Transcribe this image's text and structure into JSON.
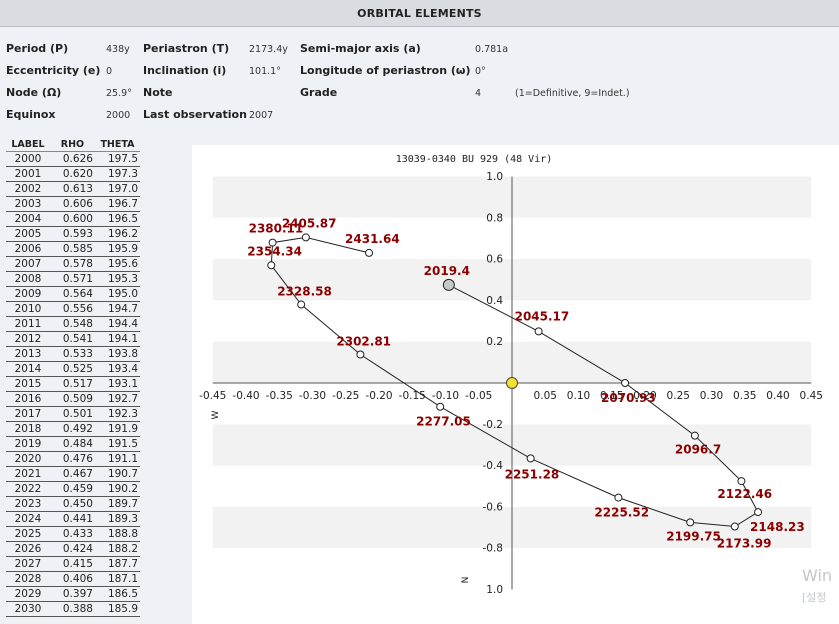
{
  "header": {
    "title": "ORBITAL ELEMENTS"
  },
  "elements": {
    "period_label": "Period (P)",
    "period_value": "438y",
    "periastron_label": "Periastron (T)",
    "periastron_value": "2173.4y",
    "semimajor_label": "Semi-major axis (a)",
    "semimajor_value": "0.781a",
    "ecc_label": "Eccentricity (e)",
    "ecc_value": "0",
    "incl_label": "Inclination (i)",
    "incl_value": "101.1°",
    "longperi_label": "Longitude of periastron (ω)",
    "longperi_value": "0°",
    "node_label": "Node (Ω)",
    "node_value": "25.9°",
    "note_label": "Note",
    "grade_label": "Grade",
    "grade_value": "4",
    "grade_note": "(1=Definitive, 9=Indet.)",
    "equinox_label": "Equinox",
    "equinox_value": "2000",
    "lastobs_label": "Last observation",
    "lastobs_value": "2007"
  },
  "ephemeris": {
    "headers": [
      "LABEL",
      "RHO",
      "THETA"
    ],
    "rows": [
      [
        "2000",
        "0.626",
        "197.5"
      ],
      [
        "2001",
        "0.620",
        "197.3"
      ],
      [
        "2002",
        "0.613",
        "197.0"
      ],
      [
        "2003",
        "0.606",
        "196.7"
      ],
      [
        "2004",
        "0.600",
        "196.5"
      ],
      [
        "2005",
        "0.593",
        "196.2"
      ],
      [
        "2006",
        "0.585",
        "195.9"
      ],
      [
        "2007",
        "0.578",
        "195.6"
      ],
      [
        "2008",
        "0.571",
        "195.3"
      ],
      [
        "2009",
        "0.564",
        "195.0"
      ],
      [
        "2010",
        "0.556",
        "194.7"
      ],
      [
        "2011",
        "0.548",
        "194.4"
      ],
      [
        "2012",
        "0.541",
        "194.1"
      ],
      [
        "2013",
        "0.533",
        "193.8"
      ],
      [
        "2014",
        "0.525",
        "193.4"
      ],
      [
        "2015",
        "0.517",
        "193.1"
      ],
      [
        "2016",
        "0.509",
        "192.7"
      ],
      [
        "2017",
        "0.501",
        "192.3"
      ],
      [
        "2018",
        "0.492",
        "191.9"
      ],
      [
        "2019",
        "0.484",
        "191.5"
      ],
      [
        "2020",
        "0.476",
        "191.1"
      ],
      [
        "2021",
        "0.467",
        "190.7"
      ],
      [
        "2022",
        "0.459",
        "190.2"
      ],
      [
        "2023",
        "0.450",
        "189.7"
      ],
      [
        "2024",
        "0.441",
        "189.3"
      ],
      [
        "2025",
        "0.433",
        "188.8"
      ],
      [
        "2026",
        "0.424",
        "188.2"
      ],
      [
        "2027",
        "0.415",
        "187.7"
      ],
      [
        "2028",
        "0.406",
        "187.1"
      ],
      [
        "2029",
        "0.397",
        "186.5"
      ],
      [
        "2030",
        "0.388",
        "185.9"
      ]
    ]
  },
  "chart_data": {
    "type": "line",
    "title": "13039-0340 BU  929 (48 Vir)",
    "xlabel": "W",
    "ylabel": "N",
    "xlim": [
      -0.45,
      0.45
    ],
    "ylim": [
      -1.0,
      1.0
    ],
    "x_ticks": [
      "-0.45",
      "-0.40",
      "-0.35",
      "-0.30",
      "-0.25",
      "-0.20",
      "-0.15",
      "-0.10",
      "-0.05",
      "0.05",
      "0.10",
      "0.15",
      "0.20",
      "0.25",
      "0.30",
      "0.35",
      "0.40",
      "0.45"
    ],
    "y_ticks": [
      "1.0",
      "0.8",
      "0.6",
      "0.4",
      "0.2",
      "-0.2",
      "-0.4",
      "-0.6",
      "-0.8",
      "1.0"
    ],
    "grid_bands": true,
    "primary_star": [
      0,
      0
    ],
    "current_position": {
      "label": "2019.4",
      "x": -0.095,
      "y": 0.475
    },
    "orbit_points": [
      {
        "label": "2019.4",
        "x": -0.095,
        "y": 0.475
      },
      {
        "label": "2045.17",
        "x": 0.04,
        "y": 0.25
      },
      {
        "label": "2070.93",
        "x": 0.17,
        "y": 0.0
      },
      {
        "label": "2096.7",
        "x": 0.275,
        "y": -0.255
      },
      {
        "label": "2122.46",
        "x": 0.345,
        "y": -0.475
      },
      {
        "label": "2148.23",
        "x": 0.37,
        "y": -0.625
      },
      {
        "label": "2173.99",
        "x": 0.335,
        "y": -0.695
      },
      {
        "label": "2199.75",
        "x": 0.268,
        "y": -0.675
      },
      {
        "label": "2225.52",
        "x": 0.16,
        "y": -0.555
      },
      {
        "label": "2251.28",
        "x": 0.028,
        "y": -0.365
      },
      {
        "label": "2277.05",
        "x": -0.108,
        "y": -0.115
      },
      {
        "label": "2302.81",
        "x": -0.228,
        "y": 0.138
      },
      {
        "label": "2328.58",
        "x": -0.317,
        "y": 0.38
      },
      {
        "label": "2354.34",
        "x": -0.362,
        "y": 0.57
      },
      {
        "label": "2380.11",
        "x": -0.36,
        "y": 0.68
      },
      {
        "label": "2405.87",
        "x": -0.31,
        "y": 0.705
      },
      {
        "label": "2431.64",
        "x": -0.215,
        "y": 0.63
      }
    ]
  },
  "watermark": {
    "line1": "Win",
    "line2": "[설정"
  }
}
